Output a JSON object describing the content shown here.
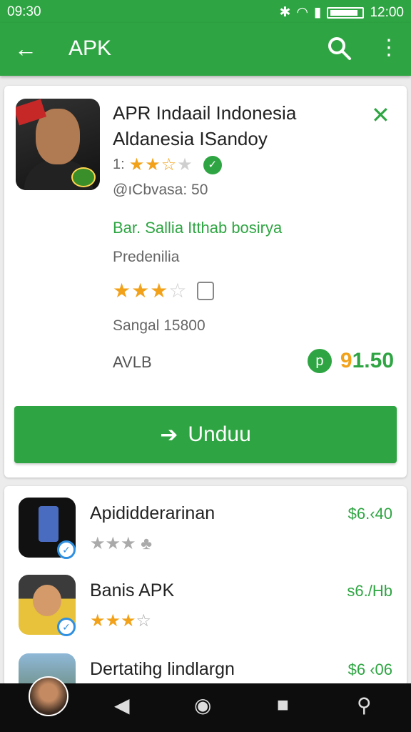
{
  "status_bar": {
    "time": "09:30",
    "clock": "12:00",
    "icons": [
      "bluetooth-icon",
      "wifi-icon",
      "signal-icon",
      "battery-icon"
    ]
  },
  "app_bar": {
    "title": "APK",
    "back_icon": "arrow-left-icon",
    "search_icon": "search-icon",
    "more_icon": "more-vert-icon"
  },
  "app": {
    "title_line1": "APR Indaail Indonesia",
    "title_line2": "Aldanesia ISandoy",
    "rating_prefix": "1:",
    "stars": 2.5,
    "downloads_text": "@ıCbvasa: 50",
    "developer": "Bar. Sallia Itthab bosirya",
    "category": "Predenilia",
    "rating_detail_stars": 3.5,
    "size_text": "Sangal 15800",
    "label_left": "AVLB",
    "price": "1.50",
    "price_symbol": "9",
    "download_label": "Unduu"
  },
  "related": [
    {
      "name": "Apididderarinan",
      "price": "$6.‹40",
      "stars_filled": 0,
      "stars_total": 4
    },
    {
      "name": "Banis APK",
      "price": "s6./Hb",
      "stars_filled": 2.5,
      "stars_total": 4
    },
    {
      "name": "Dertatihg lindlargn",
      "price": "$6 ‹06",
      "stars_filled": 0,
      "stars_total": 0
    }
  ],
  "colors": {
    "accent": "#2ea542",
    "star": "#f2a21a",
    "check": "#2f8fe0"
  },
  "nav": [
    "avatar",
    "back-triangle-icon",
    "home-circle-icon",
    "recents-square-icon",
    "accessibility-icon"
  ]
}
